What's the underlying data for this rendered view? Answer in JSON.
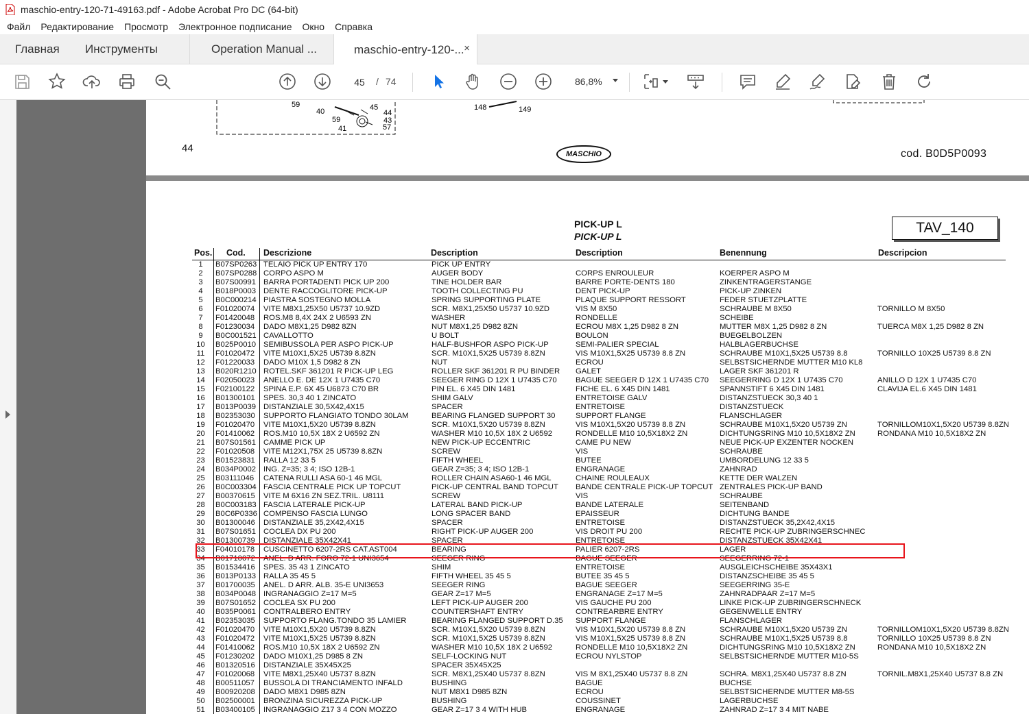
{
  "window": {
    "title": "maschio-entry-120-71-49163.pdf - Adobe Acrobat Pro DC (64-bit)"
  },
  "menu": [
    "Файл",
    "Редактирование",
    "Просмотр",
    "Электронное подписание",
    "Окно",
    "Справка"
  ],
  "tabs": {
    "home": "Главная",
    "tools": "Инструменты",
    "doc1": "Operation Manual ...",
    "doc2": "maschio-entry-120-...",
    "close": "×"
  },
  "toolbar": {
    "page_current": "45",
    "page_sep": "/",
    "page_total": "74",
    "zoom": "86,8%"
  },
  "page_prev": {
    "page_number": "44",
    "code": "cod.  B0D5P0093",
    "logo": "MASCHIO",
    "drawing_labels": [
      "59",
      "40",
      "45",
      "44",
      "43",
      "59",
      "41",
      "57",
      "148",
      "149"
    ]
  },
  "page": {
    "title_it": "PICK-UP L",
    "title_en": "PICK-UP L",
    "tav": "TAV_140",
    "headers": {
      "pos": "Pos.",
      "cod": "Cod.",
      "it": "Descrizione",
      "en": "Description",
      "fr": "Description",
      "de": "Benennung",
      "es": "Descripcion"
    },
    "rows": [
      [
        "1",
        "B07SP0263",
        "TELAIO PICK UP ENTRY 170",
        "PICK UP ENTRY",
        "",
        "",
        ""
      ],
      [
        "2",
        "B07SP0288",
        "CORPO ASPO M",
        "AUGER BODY",
        "CORPS ENROULEUR",
        "KOERPER ASPO M",
        ""
      ],
      [
        "3",
        "B07S00991",
        "BARRA PORTADENTI PICK UP 200",
        "TINE HOLDER BAR",
        "BARRE PORTE-DENTS 180",
        "ZINKENTRAGERSTANGE",
        ""
      ],
      [
        "4",
        "B018P0003",
        "DENTE RACCOGLITORE PICK-UP",
        "TOOTH COLLECTING PU",
        "DENT PICK-UP",
        "PICK-UP ZINKEN",
        ""
      ],
      [
        "5",
        "B0C000214",
        "PIASTRA SOSTEGNO MOLLA",
        "SPRING SUPPORTING PLATE",
        "PLAQUE SUPPORT RESSORT",
        "FEDER STUETZPLATTE",
        ""
      ],
      [
        "6",
        "F01020074",
        "VITE M8X1,25X50   U5737 10.9ZD",
        "SCR. M8X1,25X50   U5737 10.9ZD",
        "VIS M 8X50",
        "SCHRAUBE M 8X50",
        "TORNILLO M 8X50"
      ],
      [
        "7",
        "F01420048",
        "ROS.M8   8,4X  24X  2 U6593 ZN",
        "WASHER",
        "RONDELLE",
        "SCHEIBE",
        ""
      ],
      [
        "8",
        "F01230034",
        "DADO M8X1,25      D982      8ZN",
        "NUT M8X1,25       D982       8ZN",
        "ECROU M8X 1,25 D982  8  ZN",
        "MUTTER M8X 1,25 D982  8  ZN",
        "TUERCA M8X 1,25 D982  8  ZN"
      ],
      [
        "9",
        "B0C001521",
        "CAVALLOTTO",
        "U BOLT",
        "BOULON",
        "BUEGELBOLZEN",
        ""
      ],
      [
        "10",
        "B025P0010",
        "SEMIBUSSOLA PER ASPO  PICK-UP",
        "HALF-BUSHFOR ASPO PICK-UP",
        "SEMI-PALIER SPECIAL",
        "HALBLAGERBUCHSE",
        ""
      ],
      [
        "11",
        "F01020472",
        "VITE M10X1,5X25  U5739 8.8ZN",
        "SCR. M10X1,5X25   U5739  8.8ZN",
        "VIS M10X1,5X25 U5739  8.8 ZN",
        "SCHRAUBE M10X1,5X25 U5739  8.8",
        "TORNILLO 10X25 U5739 8.8 ZN"
      ],
      [
        "12",
        "F01220033",
        "DADO M10X 1,5     D982   8   ZN",
        "NUT",
        "ECROU",
        "SELBSTSICHERNDE MUTTER M10 KL8",
        ""
      ],
      [
        "13",
        "B020R1210",
        "ROTEL.SKF 361201 R PICK-UP LEG",
        "ROLLER SKF 361201 R PU BINDER",
        "GALET",
        "LAGER SKF 361201 R",
        ""
      ],
      [
        "14",
        "F02050023",
        "ANELLO E. DE 12X   1 U7435 C70",
        "SEEGER RING D 12X 1 U7435 C70",
        "BAGUE SEEGER D 12X 1 U7435 C70",
        "SEEGERRING D 12X 1 U7435 C70",
        "ANILLO D 12X 1 U7435 C70"
      ],
      [
        "15",
        "F02100122",
        "SPINA E.P.  6X 45 U6873 C70 BR",
        "PIN EL. 6 X45 DIN 1481",
        "FICHE EL. 6 X45 DIN 1481",
        "SPANNSTIFT 6 X45 DIN 1481",
        "CLAVIJA EL.6 X45 DIN 1481"
      ],
      [
        "16",
        "B01300101",
        "SPES. 30,3 40 1     ZINCATO",
        "SHIM   GALV",
        "ENTRETOISE  GALV",
        "DISTANZSTUECK 30,3 40 1",
        ""
      ],
      [
        "17",
        "B013P0039",
        "DISTANZIALE 30,5X42,4X15",
        "SPACER",
        "ENTRETOISE",
        "DISTANZSTUECK",
        ""
      ],
      [
        "18",
        "B02353030",
        "SUPPORTO FLANGIATO TONDO 30LAM",
        "BEARING FLANGED SUPPORT 30",
        "SUPPORT FLANGE",
        "FLANSCHLAGER",
        ""
      ],
      [
        "19",
        "F01020470",
        "VITE M10X1,5X20   U5739  8.8ZN",
        "SCR. M10X1,5X20   U5739  8.8ZN",
        "VIS M10X1,5X20 U5739  8.8 ZN",
        "SCHRAUBE M10X1,5X20 U5739 ZN",
        "TORNILLOM10X1,5X20 U5739 8.8ZN"
      ],
      [
        "20",
        "F01410062",
        "ROS.M10 10,5X 18X  2 U6592 ZN",
        "WASHER M10 10,5X  18X  2 U6592",
        "RONDELLE M10 10,5X18X2 ZN",
        "DICHTUNGSRING M10 10,5X18X2 ZN",
        "RONDANA M10 10,5X18X2 ZN"
      ],
      [
        "21",
        "B07S01561",
        "CAMME PICK UP",
        "NEW PICK-UP ECCENTRIC",
        "CAME PU NEW",
        "NEUE PICK-UP EXZENTER NOCKEN",
        ""
      ],
      [
        "22",
        "F01020508",
        "VITE M12X1,75X 25 U5739  8.8ZN",
        "SCREW",
        "VIS",
        "SCHRAUBE",
        ""
      ],
      [
        "23",
        "B01523831",
        "RALLA 12 33 5",
        "FIFTH WHEEL",
        "BUTEE",
        "UMBORDELUNG 12 33 5",
        ""
      ],
      [
        "24",
        "B034P0002",
        "ING. Z=35; 3 4; ISO 12B-1",
        "GEAR Z=35; 3 4; ISO 12B-1",
        "ENGRANAGE",
        "ZAHNRAD",
        ""
      ],
      [
        "25",
        "B03111046",
        "CATENA RULLI ASA 60-1  46 MGL",
        "ROLLER CHAIN ASA60-1 46 MGL",
        "CHAINE ROULEAUX",
        "KETTE DER WALZEN",
        ""
      ],
      [
        "26",
        "B0C003304",
        "FASCIA CENTRALE PICK UP TOPCUT",
        "PICK-UP CENTRAL BAND TOPCUT",
        "BANDE CENTRALE PICK-UP TOPCUT",
        "ZENTRALES PICK-UP BAND",
        ""
      ],
      [
        "27",
        "B00370615",
        "VITE M 6X16 ZN SEZ.TRIL. U8111",
        "SCREW",
        "VIS",
        "SCHRAUBE",
        ""
      ],
      [
        "28",
        "B0C003183",
        "FASCIA LATERALE PICK-UP",
        "LATERAL BAND PICK-UP",
        "BANDE LATERALE",
        "SEITENBAND",
        ""
      ],
      [
        "29",
        "B0C6P0336",
        "COMPENSO FASCIA LUNGO",
        "LONG SPACER BAND",
        "EPAISSEUR",
        "DICHTUNG  BANDE",
        ""
      ],
      [
        "30",
        "B01300046",
        "DISTANZIALE 35,2X42,4X15",
        "SPACER",
        "ENTRETOISE",
        "DISTANZSTUECK 35,2X42,4X15",
        ""
      ],
      [
        "31",
        "B07S01651",
        "COCLEA DX PU 200",
        "RIGHT PICK-UP AUGER 200",
        "VIS DROIT PU 200",
        "RECHTE PICK-UP ZUBRINGERSCHNEC",
        ""
      ],
      [
        "32",
        "B01300739",
        "DISTANZIALE 35X42X41",
        "SPACER",
        "ENTRETOISE",
        "DISTANZSTUECK 35X42X41",
        ""
      ],
      [
        "33",
        "F04010178",
        "CUSCINETTO 6207-2RS CAT.AST004",
        "BEARING",
        "PALIER 6207-2RS",
        "LAGER",
        ""
      ],
      [
        "34",
        "B01710072",
        "ANEL. D ARR. FORO 72-1 UNI3654",
        "SEEGER RING",
        "BAGUE SEEGER",
        "SEEGERRING  72-1",
        ""
      ],
      [
        "35",
        "B01534416",
        "SPES. 35 43 1       ZINCATO",
        "SHIM",
        "ENTRETOISE",
        "AUSGLEICHSCHEIBE 35X43X1",
        ""
      ],
      [
        "36",
        "B013P0133",
        "RALLA 35 45 5",
        "FIFTH WHEEL 35 45 5",
        "BUTEE 35 45 5",
        "DISTANZSCHEIBE 35 45 5",
        ""
      ],
      [
        "37",
        "B01700035",
        "ANEL. D ARR. ALB. 35-E UNI3653",
        "SEEGER RING",
        "BAGUE SEEGER",
        "SEEGERRING  35-E",
        ""
      ],
      [
        "38",
        "B034P0048",
        "INGRANAGGIO Z=17 M=5",
        "GEAR Z=17 M=5",
        "ENGRANAGE Z=17 M=5",
        "ZAHNRADPAAR Z=17 M=5",
        ""
      ],
      [
        "39",
        "B07S01652",
        "COCLEA SX PU 200",
        "LEFT PICK-UP AUGER 200",
        "VIS GAUCHE PU 200",
        "LINKE PICK-UP ZUBRINGERSCHNECK",
        ""
      ],
      [
        "40",
        "B035P0061",
        "CONTRALBERO ENTRY",
        "COUNTERSHAFT ENTRY",
        "CONTREARBRE ENTRY",
        "GEGENWELLE ENTRY",
        ""
      ],
      [
        "41",
        "B02353035",
        "SUPPORTO FLANG.TONDO 35 LAMIER",
        "BEARING FLANGED SUPPORT D.35",
        "SUPPORT FLANGE",
        "FLANSCHLAGER",
        ""
      ],
      [
        "42",
        "F01020470",
        "VITE M10X1,5X20   U5739  8.8ZN",
        "SCR. M10X1,5X20   U5739  8.8ZN",
        "VIS M10X1,5X20 U5739  8.8 ZN",
        "SCHRAUBE M10X1,5X20 U5739 ZN",
        "TORNILLOM10X1,5X20 U5739 8.8ZN"
      ],
      [
        "43",
        "F01020472",
        "VITE M10X1,5X25  U5739 8.8ZN",
        "SCR. M10X1,5X25   U5739  8.8ZN",
        "VIS M10X1,5X25 U5739  8.8 ZN",
        "SCHRAUBE M10X1,5X25 U5739  8.8",
        "TORNILLO 10X25 U5739 8.8 ZN"
      ],
      [
        "44",
        "F01410062",
        "ROS.M10 10,5X 18X  2 U6592 ZN",
        "WASHER M10 10,5X  18X  2 U6592",
        "RONDELLE M10 10,5X18X2 ZN",
        "DICHTUNGSRING M10 10,5X18X2 ZN",
        "RONDANA M10 10,5X18X2 ZN"
      ],
      [
        "45",
        "F01230202",
        "DADO M10X1,25    D985   8   ZN",
        "SELF-LOCKING NUT",
        "ECROU NYLSTOP",
        "SELBSTSICHERNDE MUTTER M10-5S",
        ""
      ],
      [
        "46",
        "B01320516",
        "DISTANZIALE 35X45X25",
        "SPACER 35X45X25",
        "",
        "",
        ""
      ],
      [
        "47",
        "F01020068",
        "VITE M8X1,25X40  U5737 8.8ZN",
        "SCR. M8X1,25X40   U5737  8.8ZN",
        "VIS M 8X1,25X40 U5737  8.8 ZN",
        "SCHRA. M8X1,25X40 U5737 8.8 ZN",
        "TORNIL.M8X1,25X40 U5737 8.8 ZN"
      ],
      [
        "48",
        "B00511057",
        "BUSSOLA DI TRANCIAMENTO INFALD",
        "BUSHING",
        "BAGUE",
        "BUCHSE",
        ""
      ],
      [
        "49",
        "B00920208",
        "DADO M8X1       D985     8ZN",
        "NUT M8X1  D985 8ZN",
        "ECROU",
        "SELBSTSICHERNDE MUTTER M8-5S",
        ""
      ],
      [
        "50",
        "B02500001",
        "BRONZINA SICUREZZA PICK-UP",
        "BUSHING",
        "COUSSINET",
        "LAGERBUCHSE",
        ""
      ],
      [
        "51",
        "B03400105",
        "INGRANAGGIO Z17 3 4  CON MOZZO",
        "GEAR Z=17 3 4  WITH HUB",
        "ENGRANAGE",
        "ZAHNRAD Z=17 3 4  MIT NABE",
        ""
      ]
    ]
  }
}
